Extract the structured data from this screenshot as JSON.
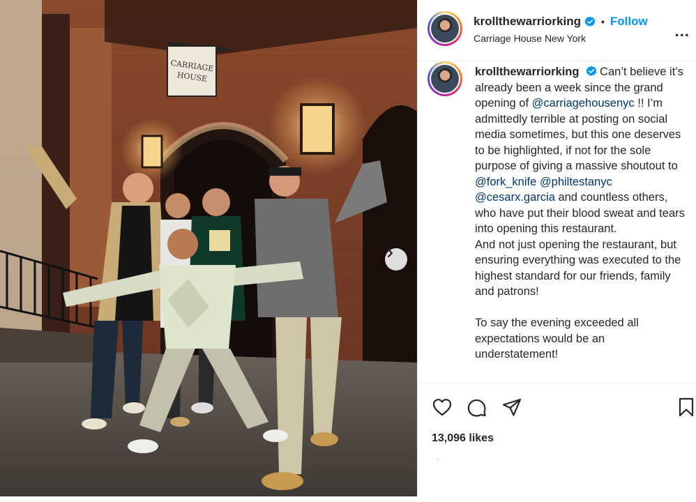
{
  "post": {
    "username": "krollthewarriorking",
    "separator": "•",
    "follow_label": "Follow",
    "location": "Carriage House New York",
    "more_label": "...",
    "sign_text": [
      "CARRIAGE",
      "HOUSE"
    ],
    "caption": {
      "username": "krollthewarriorking",
      "part1": "Can’t believe it’s already been a week since the grand opening of ",
      "mention1": "@carriagehousenyc",
      "part2": " !! I’m admittedly terrible at posting on social media sometimes, but this one deserves to be highlighted, if not for the sole purpose of giving a massive shoutout to ",
      "mention2": "@fork_knife",
      "mention3": "@philtestanyc",
      "mention4": "@cesarx.garcia",
      "part3": " and countless others, who have put their blood sweat and tears into opening this restaurant.",
      "part4": "And not just opening the restaurant, but ensuring everything was executed to the highest standard for our friends, family and patrons!",
      "part5": "To say the evening exceeded all expectations would be an understatement!"
    },
    "likes": "13,096 likes"
  },
  "icons": {
    "verified": "verified-badge",
    "like": "heart-icon",
    "comment": "comment-icon",
    "share": "share-icon",
    "save": "bookmark-icon",
    "next": "chevron-right-icon"
  },
  "colors": {
    "follow": "#0095f6",
    "mention": "#00376b",
    "verified": "#0095f6",
    "text": "#262626"
  }
}
